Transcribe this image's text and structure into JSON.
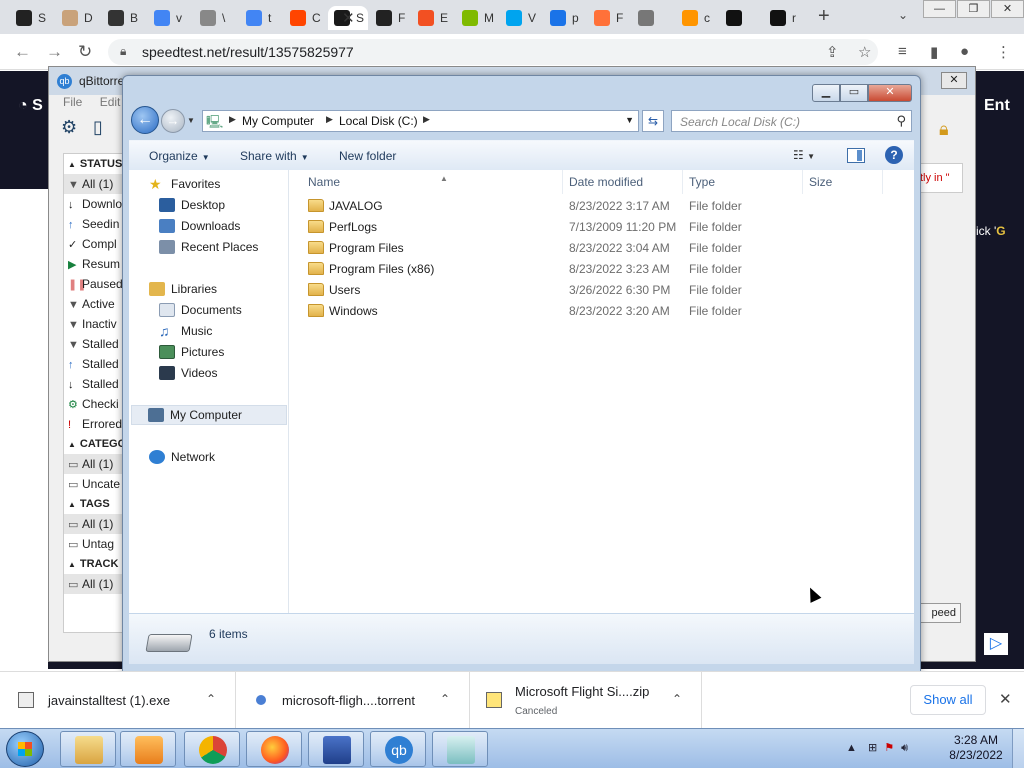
{
  "browser": {
    "tabs": [
      {
        "label": "S",
        "color": "#222222"
      },
      {
        "label": "D",
        "color": "#c9a27a"
      },
      {
        "label": "B",
        "color": "#333333"
      },
      {
        "label": "v",
        "color": "#4285f4"
      },
      {
        "label": "\\",
        "color": "#888888"
      },
      {
        "label": "t",
        "color": "#4285f4"
      },
      {
        "label": "C",
        "color": "#ff4500"
      },
      {
        "label": "S",
        "color": "#1a1a1a"
      },
      {
        "label": "F",
        "color": "#222222"
      },
      {
        "label": "E",
        "color": "#f25022"
      },
      {
        "label": "M",
        "color": "#7fba00"
      },
      {
        "label": "V",
        "color": "#00a4ef"
      },
      {
        "label": "p",
        "color": "#1a73e8"
      },
      {
        "label": "F",
        "color": "#ff7139"
      },
      {
        "label": "",
        "color": "#777777"
      },
      {
        "label": "c",
        "color": "#ff9500"
      },
      {
        "label": "",
        "color": "#111111"
      },
      {
        "label": "r",
        "color": "#111111"
      }
    ],
    "url": "speedtest.net/result/13575825977",
    "page_heading_fragment": "Ent",
    "page_text_fragment_pre": "ick '",
    "page_text_fragment_hl": "G"
  },
  "qbittorrent": {
    "title": "qBittorre",
    "menu": [
      "File",
      "Edit"
    ],
    "status_header": "STATUS",
    "status_items": [
      {
        "label": "All (1)",
        "icon": "filter-icon"
      },
      {
        "label": "Downlo",
        "icon": "down-arrow-icon"
      },
      {
        "label": "Seedin",
        "icon": "up-arrow-icon"
      },
      {
        "label": "Compl",
        "icon": "check-icon"
      },
      {
        "label": "Resum",
        "icon": "play-icon"
      },
      {
        "label": "Paused",
        "icon": "pause-icon"
      },
      {
        "label": "Active",
        "icon": "filter-icon"
      },
      {
        "label": "Inactiv",
        "icon": "filter-icon"
      },
      {
        "label": "Stalled",
        "icon": "filter-icon"
      },
      {
        "label": "Stalled",
        "icon": "up-arrow-icon"
      },
      {
        "label": "Stalled",
        "icon": "down-arrow-icon"
      },
      {
        "label": "Checki",
        "icon": "gear-icon"
      },
      {
        "label": "Errored",
        "icon": "error-icon"
      }
    ],
    "categories_header": "CATEGO",
    "category_items": [
      "All (1)",
      "Uncate"
    ],
    "tags_header": "TAGS",
    "tag_items": [
      "All (1)",
      "Untag"
    ],
    "trackers_header": "TRACK",
    "tracker_items": [
      "All (1)"
    ],
    "right_fragment": "tly in \"",
    "speed_fragment": "peed"
  },
  "explorer": {
    "address": {
      "crumbs": [
        "My Computer",
        "Local Disk (C:)"
      ]
    },
    "search_placeholder": "Search Local Disk (C:)",
    "commands": {
      "organize": "Organize",
      "share_with": "Share with",
      "new_folder": "New folder"
    },
    "nav": {
      "favorites": "Favorites",
      "favorites_items": [
        "Desktop",
        "Downloads",
        "Recent Places"
      ],
      "libraries": "Libraries",
      "libraries_items": [
        "Documents",
        "Music",
        "Pictures",
        "Videos"
      ],
      "computer": "My Computer",
      "network": "Network"
    },
    "columns": [
      "Name",
      "Date modified",
      "Type",
      "Size"
    ],
    "rows": [
      {
        "name": "JAVALOG",
        "date": "8/23/2022 3:17 AM",
        "type": "File folder"
      },
      {
        "name": "PerfLogs",
        "date": "7/13/2009 11:20 PM",
        "type": "File folder"
      },
      {
        "name": "Program Files",
        "date": "8/23/2022 3:04 AM",
        "type": "File folder"
      },
      {
        "name": "Program Files (x86)",
        "date": "8/23/2022 3:23 AM",
        "type": "File folder"
      },
      {
        "name": "Users",
        "date": "3/26/2022 6:30 PM",
        "type": "File folder"
      },
      {
        "name": "Windows",
        "date": "8/23/2022 3:20 AM",
        "type": "File folder"
      }
    ],
    "item_count": "6 items"
  },
  "downloads": {
    "items": [
      {
        "name": "javainstalltest (1).exe",
        "status": ""
      },
      {
        "name": "microsoft-fligh....torrent",
        "status": ""
      },
      {
        "name": "Microsoft Flight Si....zip",
        "status": "Canceled"
      }
    ],
    "show_all": "Show all"
  },
  "taskbar": {
    "apps": [
      "windows-explorer",
      "media-player",
      "chrome",
      "firefox",
      "notepad-app",
      "qbittorrent",
      "generic-app"
    ],
    "time": "3:28 AM",
    "date": "8/23/2022"
  }
}
